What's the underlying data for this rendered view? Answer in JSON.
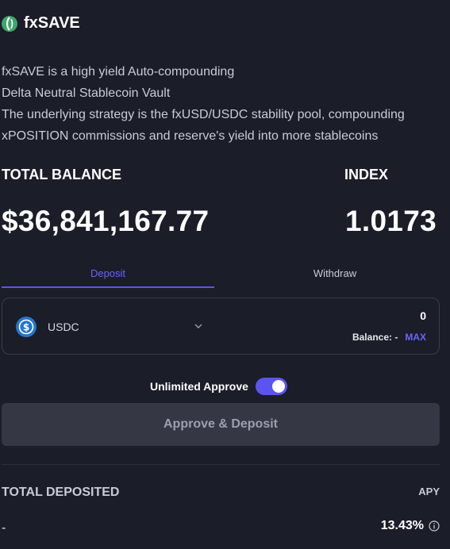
{
  "header": {
    "title": "fxSAVE",
    "logo_icon": "fx-protocol-logo-icon",
    "logo_color": "#3fa56b"
  },
  "description": [
    "fxSAVE is a high yield Auto-compounding",
    "Delta Neutral Stablecoin Vault",
    "The underlying strategy is the fxUSD/USDC stability pool, compounding",
    "xPOSITION commissions and reserve's yield into more stablecoins"
  ],
  "stats": {
    "total_balance_label": "TOTAL BALANCE",
    "total_balance_value": "$36,841,167.77",
    "index_label": "INDEX",
    "index_value": "1.0173"
  },
  "tabs": [
    {
      "label": "Deposit",
      "active": true
    },
    {
      "label": "Withdraw",
      "active": false
    }
  ],
  "token_input": {
    "token_icon": "usdc-coin-icon",
    "token_name": "USDC",
    "dropdown_icon": "chevron-down-icon",
    "amount": "0",
    "balance_label": "Balance: -",
    "max_label": "MAX"
  },
  "approve": {
    "label": "Unlimited Approve",
    "enabled": true
  },
  "cta": {
    "label": "Approve & Deposit"
  },
  "deposited": {
    "total_label": "TOTAL DEPOSITED",
    "total_value": "-",
    "apy_label": "APY",
    "apy_value": "13.43%",
    "info_icon": "info-circle-icon"
  },
  "colors": {
    "accent": "#5b54f0",
    "background": "#1b1d29",
    "button_disabled": "#353844"
  }
}
